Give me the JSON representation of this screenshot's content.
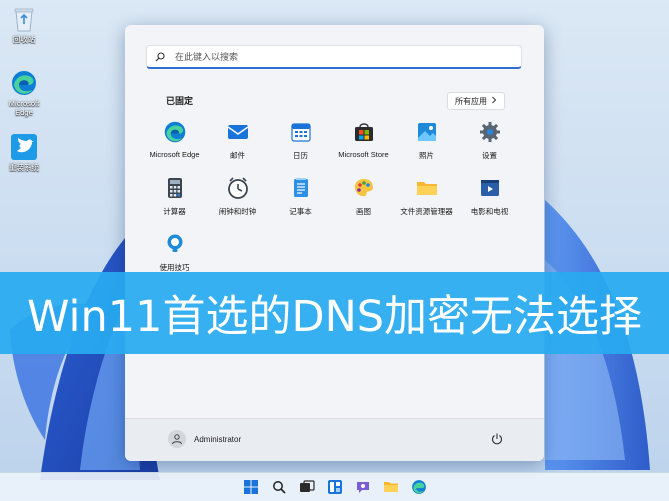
{
  "desktop": {
    "icons": [
      {
        "label": "回收站",
        "icon": "recycle-bin-icon"
      },
      {
        "label": "Microsoft Edge",
        "icon": "edge-icon"
      },
      {
        "label": "重装系统",
        "icon": "bird-icon"
      }
    ]
  },
  "start_menu": {
    "search_placeholder": "在此键入以搜索",
    "pinned_title": "已固定",
    "all_apps_label": "所有应用",
    "apps": [
      {
        "label": "Microsoft Edge",
        "icon": "edge-icon"
      },
      {
        "label": "邮件",
        "icon": "mail-icon"
      },
      {
        "label": "日历",
        "icon": "calendar-icon"
      },
      {
        "label": "Microsoft Store",
        "icon": "store-icon"
      },
      {
        "label": "照片",
        "icon": "photos-icon"
      },
      {
        "label": "设置",
        "icon": "gear-icon"
      },
      {
        "label": "计算器",
        "icon": "calculator-icon"
      },
      {
        "label": "闹钟和时钟",
        "icon": "alarm-clock-icon"
      },
      {
        "label": "记事本",
        "icon": "notepad-icon"
      },
      {
        "label": "画图",
        "icon": "paint-icon"
      },
      {
        "label": "文件资源管理器",
        "icon": "folder-icon"
      },
      {
        "label": "电影和电视",
        "icon": "movies-icon"
      },
      {
        "label": "使用技巧",
        "icon": "tips-icon"
      }
    ],
    "user_name": "Administrator"
  },
  "banner": {
    "text": "Win11首选的DNS加密无法选择"
  },
  "colors": {
    "accent": "#2f6fd1",
    "banner": "#28aaf0"
  }
}
